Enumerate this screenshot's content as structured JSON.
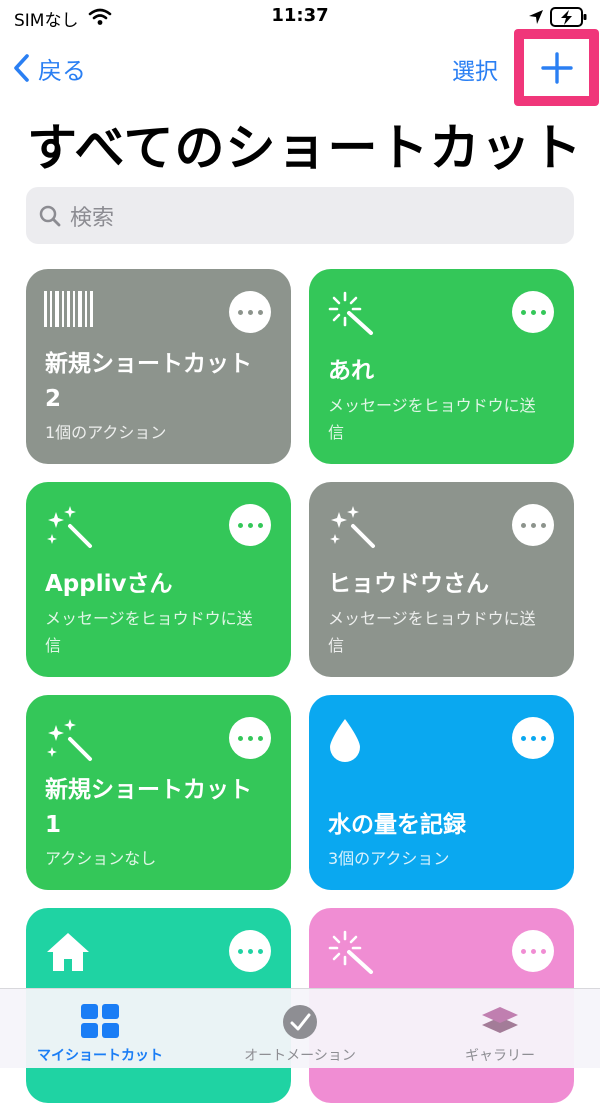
{
  "status_bar": {
    "carrier": "SIMなし",
    "time": "11:37"
  },
  "nav": {
    "back_label": "戻る",
    "select_label": "選択",
    "add_icon": "plus-icon"
  },
  "page_title": "すべてのショートカット",
  "search": {
    "placeholder": "検索"
  },
  "shortcuts": [
    {
      "name": "新規ショートカット 2",
      "subtitle": "1個のアクション",
      "color": "#8d948d",
      "icon": "barcode-icon"
    },
    {
      "name": "あれ",
      "subtitle": "メッセージをヒョウドウに送信",
      "color": "#34c759",
      "icon": "magic-wand-icon"
    },
    {
      "name": "Applivさん",
      "subtitle": "メッセージをヒョウドウに送信",
      "color": "#34c759",
      "icon": "sparkle-wand-icon"
    },
    {
      "name": "ヒョウドウさん",
      "subtitle": "メッセージをヒョウドウに送信",
      "color": "#8d948d",
      "icon": "sparkle-wand-icon"
    },
    {
      "name": "新規ショートカット 1",
      "subtitle": "アクションなし",
      "color": "#34c759",
      "icon": "sparkle-wand-icon"
    },
    {
      "name": "水の量を記録",
      "subtitle": "3個のアクション",
      "color": "#0aa8f0",
      "icon": "water-drop-icon"
    },
    {
      "name": "",
      "subtitle": "",
      "color": "#1fd3a3",
      "icon": "home-icon"
    },
    {
      "name": "",
      "subtitle": "",
      "color": "#f08dd3",
      "icon": "magic-wand-icon"
    }
  ],
  "tabs": [
    {
      "label": "マイショートカット",
      "icon": "grid-icon",
      "active": true
    },
    {
      "label": "オートメーション",
      "icon": "checkmark-clock-icon",
      "active": false
    },
    {
      "label": "ギャラリー",
      "icon": "layers-icon",
      "active": false
    }
  ],
  "colors": {
    "accent": "#2a7ff3",
    "highlight": "#f0367a"
  }
}
